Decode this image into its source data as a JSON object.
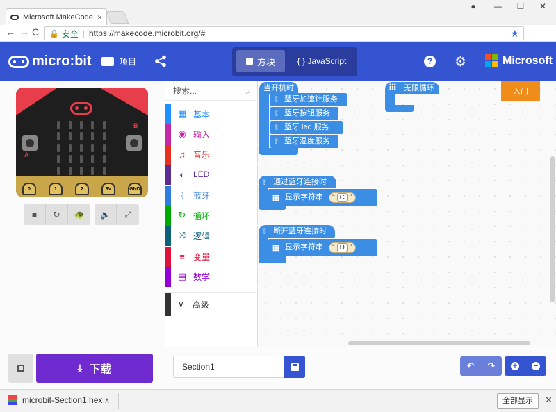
{
  "browser": {
    "tab_title": "Microsoft MakeCode fo",
    "tab_close": "×",
    "window_controls": {
      "minimize": "—",
      "maximize": "☐",
      "close": "✕"
    },
    "nav": {
      "back": "←",
      "forward": "→",
      "reload": "C"
    },
    "address": {
      "secure_label": "安全",
      "separator": "|",
      "url": "https://makecode.microbit.org/#"
    },
    "menu": "⋮"
  },
  "header": {
    "logo_text": "micro:bit",
    "projects_label": "项目",
    "mode_blocks_label": "方块",
    "mode_js_label": "{ } JavaScript",
    "help_label": "?",
    "brand": "Microsoft",
    "brand_colors": [
      "#f25022",
      "#7fba00",
      "#00a4ef",
      "#ffb900"
    ]
  },
  "simulator": {
    "button_a": "A",
    "button_b": "B",
    "pins": [
      "0",
      "1",
      "2",
      "3V",
      "GND"
    ],
    "toolbar": [
      "stop-icon",
      "restart-icon",
      "slowmo-icon",
      "mute-icon",
      "fullscreen-icon"
    ]
  },
  "toolbox": {
    "search_placeholder": "搜索...",
    "categories": [
      {
        "label": "基本",
        "color": "#1e90ff",
        "icon": "grid-icon"
      },
      {
        "label": "输入",
        "color": "#c22aa6",
        "icon": "target-icon"
      },
      {
        "label": "音乐",
        "color": "#e63022",
        "icon": "headphones-icon"
      },
      {
        "label": "LED",
        "color": "#5c2d91",
        "icon": "toggle-icon"
      },
      {
        "label": "蓝牙",
        "color": "#2f7ce0",
        "icon": "bluetooth-icon"
      },
      {
        "label": "循环",
        "color": "#00aa00",
        "icon": "loop-icon"
      },
      {
        "label": "逻辑",
        "color": "#0c6178",
        "icon": "shuffle-icon"
      },
      {
        "label": "变量",
        "color": "#dc143c",
        "icon": "lines-icon"
      },
      {
        "label": "数学",
        "color": "#9400d3",
        "icon": "calculator-icon"
      }
    ],
    "advanced_label": "高级"
  },
  "workspace": {
    "on_start": {
      "label": "当开机时",
      "blocks": [
        "蓝牙加速计服务",
        "蓝牙按钮服务",
        "蓝牙 led 服务",
        "蓝牙温度服务"
      ]
    },
    "forever": {
      "label": "无限循环"
    },
    "on_connected": {
      "label": "通过蓝牙连接时",
      "show_label": "显示字符串",
      "value": "C"
    },
    "on_disconnected": {
      "label": "断开蓝牙连接时",
      "show_label": "显示字符串",
      "value": "D"
    },
    "starter_label": "入门",
    "block_color": "#3b8ee3"
  },
  "bottom": {
    "download_label": "下载",
    "project_name": "Section1"
  },
  "download_shelf": {
    "filename": "microbit-Section1.hex",
    "show_all_label": "全部显示"
  }
}
